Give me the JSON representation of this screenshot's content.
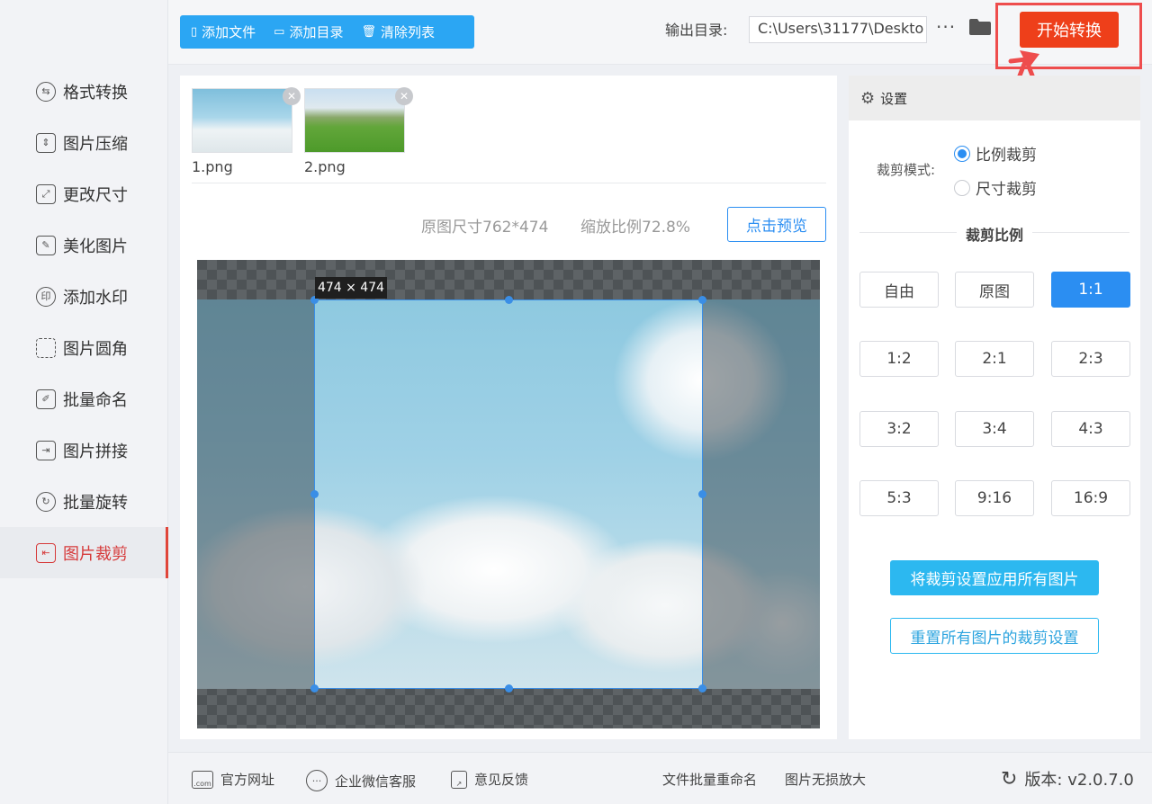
{
  "sidebar": {
    "items": [
      {
        "label": "格式转换",
        "icon": "format-convert-icon"
      },
      {
        "label": "图片压缩",
        "icon": "compress-icon"
      },
      {
        "label": "更改尺寸",
        "icon": "resize-icon"
      },
      {
        "label": "美化图片",
        "icon": "beautify-icon"
      },
      {
        "label": "添加水印",
        "icon": "watermark-icon"
      },
      {
        "label": "图片圆角",
        "icon": "rounded-corner-icon"
      },
      {
        "label": "批量命名",
        "icon": "rename-icon"
      },
      {
        "label": "图片拼接",
        "icon": "stitch-icon"
      },
      {
        "label": "批量旋转",
        "icon": "rotate-icon"
      },
      {
        "label": "图片裁剪",
        "icon": "crop-icon",
        "active": true
      }
    ]
  },
  "toolbar": {
    "add_file": "添加文件",
    "add_dir": "添加目录",
    "clear_list": "清除列表",
    "output_label": "输出目录:",
    "output_path": "C:\\Users\\31177\\Deskto",
    "more": "···",
    "start": "开始转换"
  },
  "files": [
    {
      "name": "1.png"
    },
    {
      "name": "2.png"
    }
  ],
  "preview": {
    "original_size": "原图尺寸762*474",
    "zoom": "缩放比例72.8%",
    "preview_button": "点击预览",
    "crop_size": "474 × 474"
  },
  "settings": {
    "title": "设置",
    "mode_label": "裁剪模式:",
    "modes": [
      {
        "label": "比例裁剪",
        "selected": true
      },
      {
        "label": "尺寸裁剪",
        "selected": false
      }
    ],
    "ratio_title": "裁剪比例",
    "ratios": [
      "自由",
      "原图",
      "1:1",
      "1:2",
      "2:1",
      "2:3",
      "3:2",
      "3:4",
      "4:3",
      "5:3",
      "9:16",
      "16:9"
    ],
    "selected_ratio": "1:1",
    "apply_all": "将裁剪设置应用所有图片",
    "reset_all": "重置所有图片的裁剪设置"
  },
  "footer": {
    "website": "官方网址",
    "wechat": "企业微信客服",
    "feedback": "意见反馈",
    "batch_rename": "文件批量重命名",
    "lossless": "图片无损放大",
    "version": "版本: v2.0.7.0"
  },
  "colors": {
    "accent_blue": "#2b8ef2",
    "start_red": "#ee3f1a",
    "active_red": "#d63a3a",
    "toolbar_blue": "#2ba6f3"
  }
}
